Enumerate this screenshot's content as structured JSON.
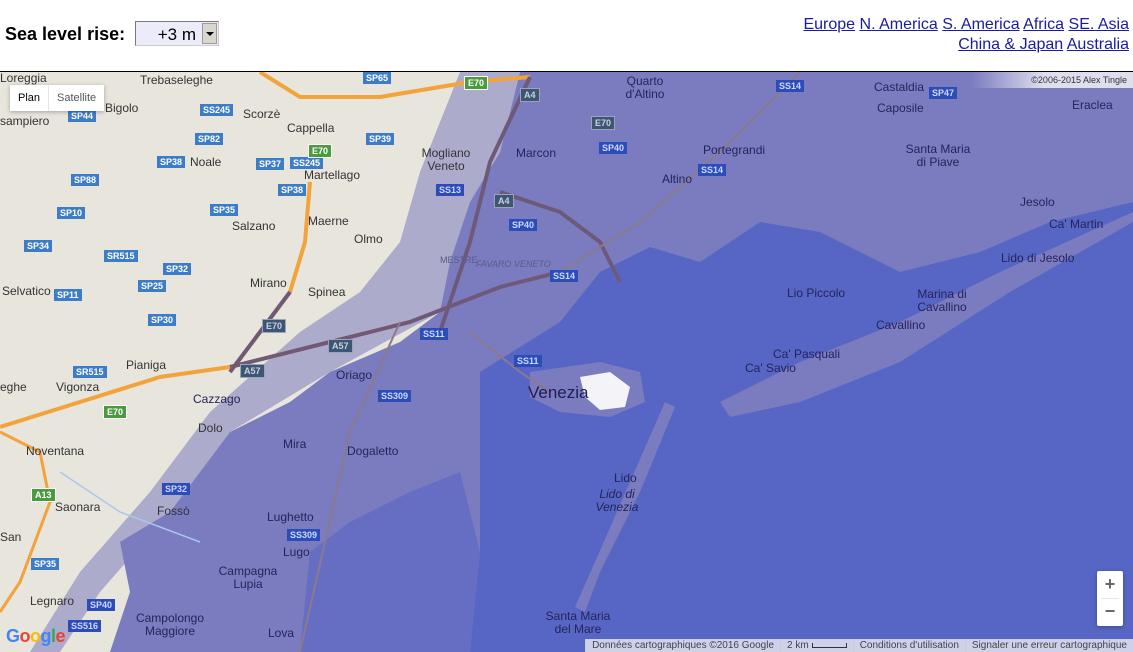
{
  "header": {
    "sea_level_label": "Sea level rise:",
    "sea_level_value": "+3 m",
    "regions": [
      "Europe",
      "N. America",
      "S. America",
      "Africa",
      "SE. Asia",
      "China & Japan",
      "Australia"
    ]
  },
  "map": {
    "maptype": {
      "plan": "Plan",
      "satellite": "Satellite",
      "selected": "Plan"
    },
    "copyright": "©2006-2015 Alex Tingle",
    "zoom_in": "+",
    "zoom_out": "−",
    "footer": {
      "data": "Données cartographiques ©2016 Google",
      "scale": "2 km",
      "terms": "Conditions d'utilisation",
      "report": "Signaler une erreur cartographique"
    },
    "google_logo": [
      "G",
      "o",
      "o",
      "g",
      "l",
      "e"
    ],
    "colors": {
      "land": "#e8e5dc",
      "flooded": "#7b7bc0",
      "sea": "#5766c4",
      "motorway": "#f2a33a",
      "flooded_road": "#6e5a78"
    },
    "places": [
      {
        "name": "Loreggia"
      },
      {
        "name": "Trebaseleghe"
      },
      {
        "name": "Bigolo"
      },
      {
        "name": "sampiero"
      },
      {
        "name": "Scorzè"
      },
      {
        "name": "Cappella"
      },
      {
        "name": "Noale"
      },
      {
        "name": "Martellago"
      },
      {
        "name": "Mogliano Veneto"
      },
      {
        "name": "Maerne"
      },
      {
        "name": "Salzano"
      },
      {
        "name": "Olmo"
      },
      {
        "name": "Mirano"
      },
      {
        "name": "Spinea"
      },
      {
        "name": "Selvatico"
      },
      {
        "name": "Pianiga"
      },
      {
        "name": "Vigonza"
      },
      {
        "name": "eghe"
      },
      {
        "name": "Cazzago"
      },
      {
        "name": "Oriago"
      },
      {
        "name": "Dolo"
      },
      {
        "name": "Noventana"
      },
      {
        "name": "Mira"
      },
      {
        "name": "Dogaletto"
      },
      {
        "name": "Fossò"
      },
      {
        "name": "Lughetto"
      },
      {
        "name": "Lugo"
      },
      {
        "name": "Campagna Lupia"
      },
      {
        "name": "Campolongo Maggiore"
      },
      {
        "name": "Lova"
      },
      {
        "name": "Saonara"
      },
      {
        "name": "San"
      },
      {
        "name": "Legnaro"
      },
      {
        "name": "Marcon"
      },
      {
        "name": "Quarto d'Altino"
      },
      {
        "name": "Altino"
      },
      {
        "name": "Portegrandi"
      },
      {
        "name": "Castaldia"
      },
      {
        "name": "Caposile"
      },
      {
        "name": "Eraclea"
      },
      {
        "name": "Santa Maria di Piave"
      },
      {
        "name": "Jesolo"
      },
      {
        "name": "Ca' Martin"
      },
      {
        "name": "Lido di Jesolo"
      },
      {
        "name": "Lio Piccolo"
      },
      {
        "name": "Marina di Cavallino"
      },
      {
        "name": "Cavallino"
      },
      {
        "name": "Ca' Pasquali"
      },
      {
        "name": "Ca' Savio"
      },
      {
        "name": "Venezia"
      },
      {
        "name": "Lido"
      },
      {
        "name": "Lido di Venezia"
      },
      {
        "name": "Santa Maria del Mare"
      },
      {
        "name": "MESTRE"
      },
      {
        "name": "FAVARO VENETO"
      }
    ],
    "shields": [
      "SP44",
      "SP65",
      "E70",
      "SS245",
      "SP82",
      "SP39",
      "SP38",
      "SP37",
      "SS245",
      "E70",
      "SP88",
      "SP38",
      "SP35",
      "SP10",
      "SS13",
      "SP34",
      "SR515",
      "SP32",
      "SP25",
      "SP11",
      "SP30",
      "SR515",
      "E70",
      "A57",
      "A57",
      "E70",
      "SS309",
      "SS11",
      "SS11",
      "SP32",
      "SS309",
      "A13",
      "SP35",
      "SP40",
      "SS516",
      "SP40",
      "SS14",
      "SS14",
      "SP40",
      "SS14",
      "SP47",
      "E70",
      "A4",
      "A4"
    ]
  }
}
